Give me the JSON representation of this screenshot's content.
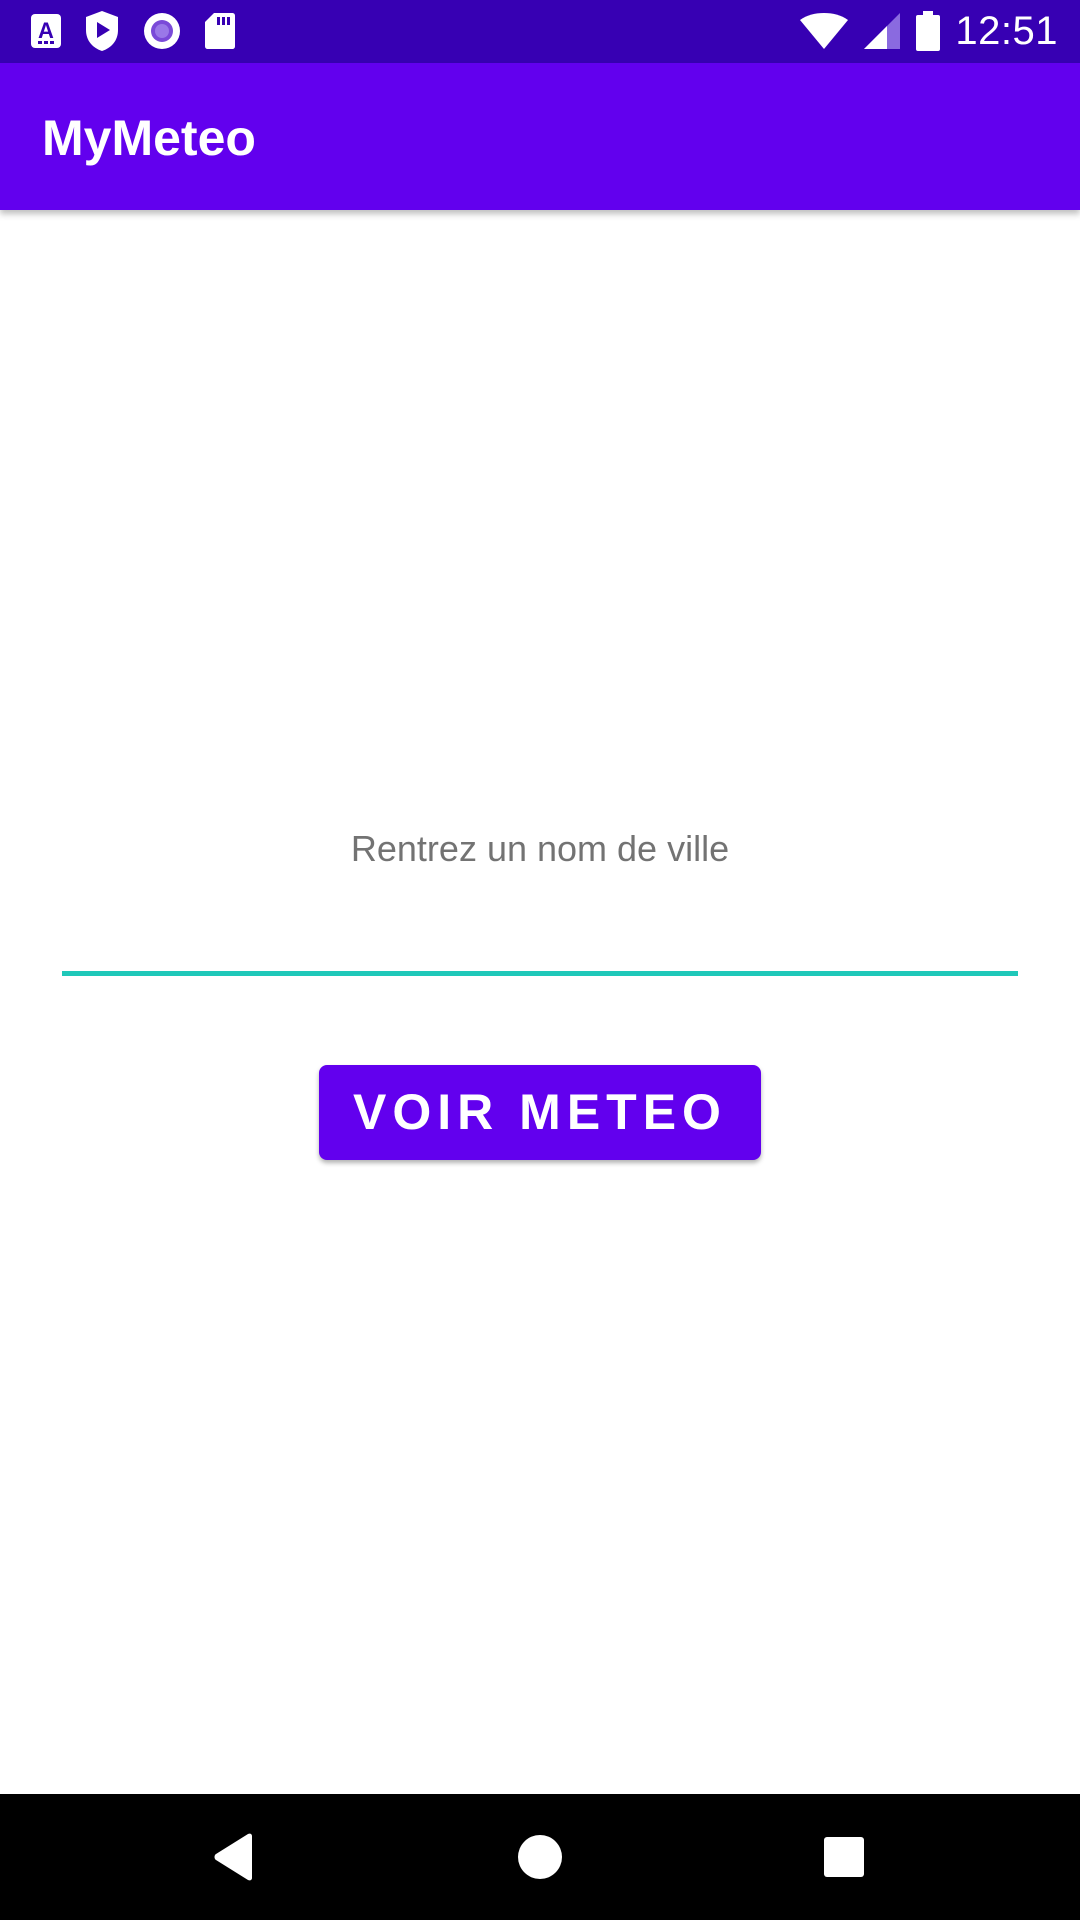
{
  "status_bar": {
    "time": "12:51",
    "left_icons": [
      "font-a-icon",
      "shield-play-icon",
      "record-circle-icon",
      "sd-card-icon"
    ],
    "right_icons": [
      "wifi-icon",
      "signal-icon",
      "battery-icon"
    ]
  },
  "app_bar": {
    "title": "MyMeteo"
  },
  "form": {
    "city_label": "Rentrez un nom de ville",
    "city_value": ""
  },
  "actions": {
    "voir_meteo_label": "VOIR METEO"
  },
  "nav_bar": {
    "icons": [
      "back-icon",
      "home-icon",
      "recents-icon"
    ]
  },
  "colors": {
    "status_bar": "#3700b3",
    "primary": "#6200ee",
    "input_underline": "#1fc8b9",
    "hint_text": "#737373"
  }
}
